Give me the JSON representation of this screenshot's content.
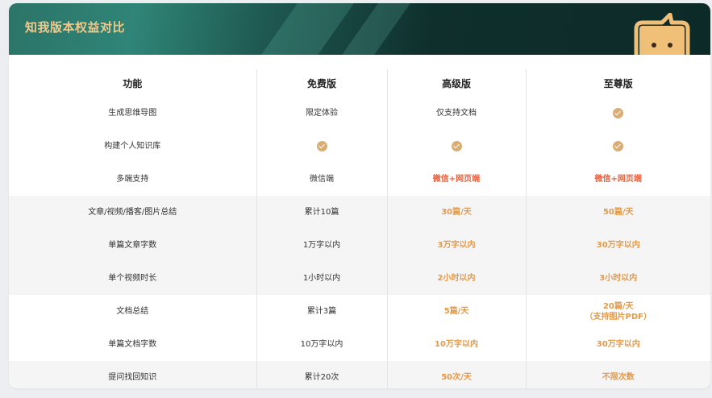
{
  "title": "知我版本权益对比",
  "columns": [
    "功能",
    "免费版",
    "高级版",
    "至尊版"
  ],
  "rows": [
    {
      "feature": "生成思维导图",
      "free": {
        "text": "限定体验"
      },
      "premium": {
        "text": "仅支持文档"
      },
      "ultimate": {
        "check": true
      }
    },
    {
      "feature": "构建个人知识库",
      "free": {
        "check": true
      },
      "premium": {
        "check": true
      },
      "ultimate": {
        "check": true
      }
    },
    {
      "feature": "多端支持",
      "free": {
        "text": "微信端"
      },
      "premium": {
        "text": "微信+网页端",
        "style": "red"
      },
      "ultimate": {
        "text": "微信+网页端",
        "style": "red"
      }
    },
    {
      "feature": "文章/视频/播客/图片总结",
      "free": {
        "text": "累计10篇"
      },
      "premium": {
        "text": "30篇/天",
        "style": "hl"
      },
      "ultimate": {
        "text": "50篇/天",
        "style": "hl"
      }
    },
    {
      "feature": "单篇文章字数",
      "free": {
        "text": "1万字以内"
      },
      "premium": {
        "text": "3万字以内",
        "style": "hl"
      },
      "ultimate": {
        "text": "30万字以内",
        "style": "hl"
      }
    },
    {
      "feature": "单个视频时长",
      "free": {
        "text": "1小时以内"
      },
      "premium": {
        "text": "2小时以内",
        "style": "hl"
      },
      "ultimate": {
        "text": "3小时以内",
        "style": "hl"
      }
    },
    {
      "feature": "文档总结",
      "free": {
        "text": "累计3篇"
      },
      "premium": {
        "text": "5篇/天",
        "style": "hl"
      },
      "ultimate": {
        "text": "20篇/天",
        "sub": "（支持图片PDF）",
        "style": "hl"
      }
    },
    {
      "feature": "单篇文档字数",
      "free": {
        "text": "10万字以内"
      },
      "premium": {
        "text": "10万字以内",
        "style": "hl"
      },
      "ultimate": {
        "text": "30万字以内",
        "style": "hl"
      }
    },
    {
      "feature": "提问找回知识",
      "free": {
        "text": "累计20次"
      },
      "premium": {
        "text": "50次/天",
        "style": "hl"
      },
      "ultimate": {
        "text": "不限次数",
        "style": "hl"
      }
    }
  ],
  "colors": {
    "accent": "#e39a4b",
    "highlight_red": "#e8603c",
    "check": "#d9ad74",
    "title": "#f3c98a"
  }
}
